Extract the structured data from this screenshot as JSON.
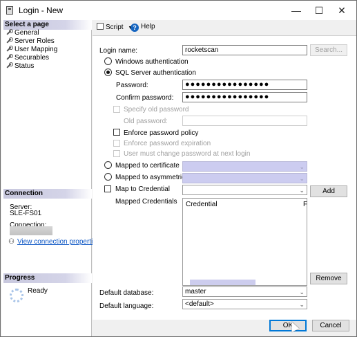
{
  "window": {
    "title": "Login - New",
    "controls": {
      "minimize": "—",
      "maximize": "☐",
      "close": "✕"
    }
  },
  "left_panel": {
    "select_page_header": "Select a page",
    "pages": [
      {
        "label": "General"
      },
      {
        "label": "Server Roles"
      },
      {
        "label": "User Mapping"
      },
      {
        "label": "Securables"
      },
      {
        "label": "Status"
      }
    ],
    "connection_header": "Connection",
    "server_label": "Server:",
    "server_value": "SLE-FS01",
    "connection_label": "Connection:",
    "view_connection_properties": "View connection properties",
    "progress_header": "Progress",
    "progress_status": "Ready"
  },
  "toolbar": {
    "script_label": "Script",
    "script_dropdown_arrow": "▼",
    "help_label": "Help"
  },
  "general": {
    "login_name_label": "Login name:",
    "login_name_value": "rocketscan",
    "search_button": "Search...",
    "windows_auth_label": "Windows authentication",
    "sql_auth_label": "SQL Server authentication",
    "password_label": "Password:",
    "password_value": "●●●●●●●●●●●●●●●●",
    "confirm_password_label": "Confirm password:",
    "confirm_password_value": "●●●●●●●●●●●●●●●●",
    "specify_old_password_label": "Specify old password",
    "old_password_label": "Old password:",
    "enforce_policy_label": "Enforce password policy",
    "enforce_expiration_label": "Enforce password expiration",
    "must_change_label": "User must change password at next login",
    "mapped_cert_label": "Mapped to certificate",
    "mapped_asym_key_label": "Mapped to asymmetric key",
    "map_credential_label": "Map to Credential",
    "add_button": "Add",
    "mapped_credentials_label": "Mapped Credentials",
    "credential_column": "Credential",
    "provider_column_partial": "F",
    "remove_button": "Remove",
    "default_database_label": "Default database:",
    "default_database_value": "master",
    "default_language_label": "Default language:",
    "default_language_value": "<default>"
  },
  "footer": {
    "ok_button": "OK",
    "cancel_button": "Cancel"
  }
}
